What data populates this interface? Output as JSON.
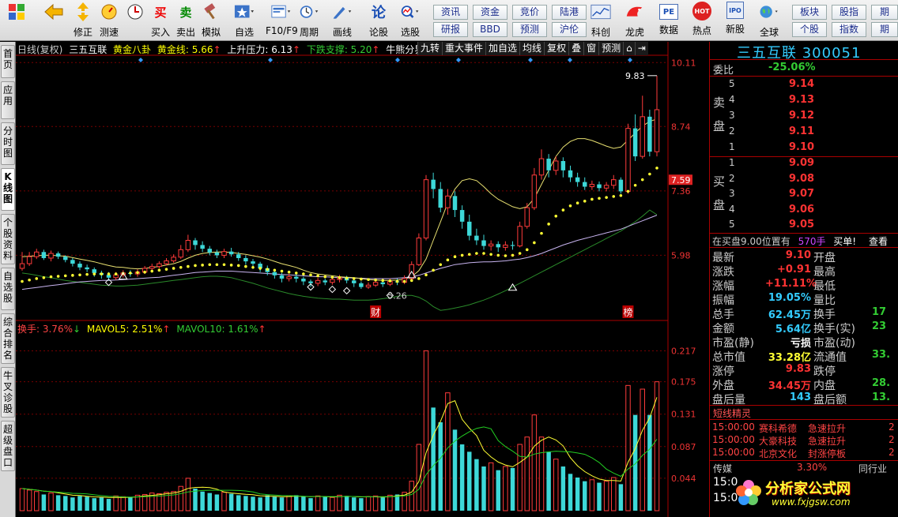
{
  "toolbar": {
    "buttons": [
      {
        "label": "",
        "icon": "grid-icon"
      },
      {
        "label": "",
        "icon": "back-arrow-icon"
      },
      {
        "label": "修正",
        "icon": "updown-arrow-icon"
      },
      {
        "label": "测速",
        "icon": "speed-icon"
      },
      {
        "label": "买入",
        "icon": "buy-icon",
        "glyph": "买"
      },
      {
        "label": "卖出",
        "icon": "sell-icon",
        "glyph": "卖"
      },
      {
        "label": "模拟",
        "icon": "hammer-icon"
      },
      {
        "label": "自选",
        "icon": "star-icon"
      },
      {
        "label": "F10/F9",
        "icon": "f10-icon"
      },
      {
        "label": "周期",
        "icon": "clock-icon"
      },
      {
        "label": "画线",
        "icon": "pen-icon"
      },
      {
        "label": "论股",
        "icon": "forum-icon",
        "glyph": "论"
      },
      {
        "label": "选股",
        "icon": "magnifier-icon"
      }
    ],
    "grid_buttons": [
      "资讯",
      "资金",
      "竞价",
      "陆港",
      "研报",
      "BBD",
      "预测",
      "沪伦"
    ],
    "buttons2": [
      {
        "label": "科创",
        "icon": "chart-icon"
      },
      {
        "label": "龙虎",
        "icon": "tiger-icon"
      },
      {
        "label": "数据",
        "icon": "pe-icon",
        "glyph": "PE"
      },
      {
        "label": "热点",
        "icon": "hot-icon",
        "glyph": "HOT"
      },
      {
        "label": "新股",
        "icon": "ipo-icon",
        "glyph": "IPO"
      },
      {
        "label": "全球",
        "icon": "globe-icon"
      }
    ],
    "grid_buttons2": [
      "板块",
      "股指",
      "期",
      "个股",
      "指数",
      "期"
    ]
  },
  "left_tabs": [
    "首页",
    "应用",
    "分时图",
    "K线图",
    "个股资料",
    "自选股",
    "综合排名",
    "牛叉诊股",
    "超级盘口"
  ],
  "chart": {
    "header": {
      "period": "日线(复权)",
      "name": "三五互联",
      "indicator": "黄金八卦",
      "gold_line": "黄金线: 5.66",
      "resistance": "上升压力: 6.13",
      "support": "下跌支撑: 5.20",
      "divider": "牛熊分界线"
    },
    "buttons": [
      "九转",
      "重大事件",
      "加自选",
      "均线",
      "复权",
      "叠",
      "窗",
      "预测"
    ],
    "price_axis": [
      "10.11",
      "8.74",
      "7.59",
      "7.36",
      "5.98"
    ],
    "price_marks": {
      "high": "9.83",
      "low": "5.26"
    },
    "event_labels": [
      "财",
      "榜"
    ],
    "vol_header": {
      "turnover": "换手: 3.76%",
      "mavol5": "MAVOL5: 2.51%",
      "mavol10": "MAVOL10: 1.61%"
    },
    "vol_axis": [
      "0.217",
      "0.175",
      "0.131",
      "0.087",
      "0.044"
    ]
  },
  "chart_data": {
    "type": "candlestick",
    "ylim": [
      4.6,
      10.25
    ],
    "candles": [
      [
        5.7,
        5.8,
        6.05,
        5.65
      ],
      [
        5.8,
        5.95,
        6.05,
        5.75
      ],
      [
        5.95,
        6.05,
        6.12,
        5.9
      ],
      [
        6.05,
        5.92,
        6.1,
        5.88
      ],
      [
        5.92,
        6.02,
        6.08,
        5.85
      ],
      [
        6.02,
        5.95,
        6.06,
        5.9
      ],
      [
        5.95,
        5.88,
        5.98,
        5.83
      ],
      [
        5.88,
        5.8,
        5.92,
        5.74
      ],
      [
        5.8,
        5.72,
        5.85,
        5.66
      ],
      [
        5.72,
        5.68,
        5.78,
        5.62
      ],
      [
        5.68,
        5.6,
        5.72,
        5.52
      ],
      [
        5.6,
        5.56,
        5.65,
        5.48
      ],
      [
        5.56,
        5.5,
        5.62,
        5.44
      ],
      [
        5.5,
        5.56,
        5.62,
        5.45
      ],
      [
        5.56,
        5.6,
        5.66,
        5.5
      ],
      [
        5.6,
        5.58,
        5.66,
        5.52
      ],
      [
        5.58,
        5.62,
        5.68,
        5.52
      ],
      [
        5.62,
        5.7,
        5.75,
        5.58
      ],
      [
        5.7,
        5.74,
        5.8,
        5.65
      ],
      [
        5.74,
        5.8,
        5.85,
        5.7
      ],
      [
        5.8,
        5.86,
        5.92,
        5.76
      ],
      [
        5.86,
        5.94,
        6.0,
        5.82
      ],
      [
        5.94,
        6.1,
        6.2,
        5.9
      ],
      [
        6.1,
        6.3,
        6.42,
        6.05
      ],
      [
        6.3,
        6.2,
        6.35,
        6.1
      ],
      [
        6.2,
        6.12,
        6.28,
        6.05
      ],
      [
        6.12,
        6.04,
        6.18,
        5.98
      ],
      [
        6.04,
        5.98,
        6.1,
        5.92
      ],
      [
        5.98,
        6.06,
        6.12,
        5.92
      ],
      [
        6.06,
        6.0,
        6.14,
        5.95
      ],
      [
        6.0,
        5.92,
        6.05,
        5.86
      ],
      [
        5.92,
        5.85,
        5.98,
        5.78
      ],
      [
        5.85,
        5.8,
        5.9,
        5.72
      ],
      [
        5.8,
        5.7,
        5.84,
        5.62
      ],
      [
        5.7,
        5.62,
        5.76,
        5.55
      ],
      [
        5.62,
        5.55,
        5.68,
        5.48
      ],
      [
        5.55,
        5.48,
        5.6,
        5.4
      ],
      [
        5.48,
        5.52,
        5.58,
        5.42
      ],
      [
        5.52,
        5.48,
        5.58,
        5.4
      ],
      [
        5.48,
        5.42,
        5.52,
        5.34
      ],
      [
        5.42,
        5.38,
        5.46,
        5.3
      ],
      [
        5.38,
        5.44,
        5.5,
        5.32
      ],
      [
        5.44,
        5.4,
        5.48,
        5.34
      ],
      [
        5.4,
        5.46,
        5.52,
        5.35
      ],
      [
        5.46,
        5.5,
        5.56,
        5.4
      ],
      [
        5.5,
        5.44,
        5.54,
        5.38
      ],
      [
        5.44,
        5.38,
        5.48,
        5.3
      ],
      [
        5.38,
        5.3,
        5.42,
        5.26
      ],
      [
        5.3,
        5.34,
        5.4,
        5.26
      ],
      [
        5.34,
        5.4,
        5.46,
        5.3
      ],
      [
        5.4,
        5.36,
        5.46,
        5.3
      ],
      [
        5.36,
        5.42,
        5.48,
        5.32
      ],
      [
        5.42,
        5.4,
        5.48,
        5.34
      ],
      [
        5.4,
        5.48,
        5.55,
        5.36
      ],
      [
        5.48,
        5.78,
        5.85,
        5.45
      ],
      [
        5.78,
        6.35,
        6.45,
        5.75
      ],
      [
        6.35,
        7.6,
        7.7,
        6.3
      ],
      [
        7.6,
        7.4,
        7.75,
        7.2
      ],
      [
        7.4,
        7.0,
        7.55,
        6.9
      ],
      [
        7.0,
        7.25,
        7.4,
        6.85
      ],
      [
        7.25,
        6.95,
        7.35,
        6.8
      ],
      [
        6.95,
        6.7,
        7.05,
        6.55
      ],
      [
        6.7,
        6.4,
        6.85,
        6.3
      ],
      [
        6.4,
        6.3,
        6.55,
        6.2
      ],
      [
        6.3,
        6.18,
        6.42,
        6.1
      ],
      [
        6.18,
        6.22,
        6.3,
        6.08
      ],
      [
        6.22,
        6.15,
        6.28,
        6.05
      ],
      [
        6.15,
        6.2,
        6.28,
        6.08
      ],
      [
        6.2,
        6.18,
        6.28,
        6.1
      ],
      [
        6.18,
        6.6,
        6.7,
        6.15
      ],
      [
        6.6,
        7.0,
        7.1,
        6.55
      ],
      [
        7.0,
        7.7,
        7.85,
        6.95
      ],
      [
        7.7,
        8.05,
        8.25,
        7.6
      ],
      [
        8.05,
        7.8,
        8.15,
        7.65
      ],
      [
        7.8,
        8.0,
        8.1,
        7.7
      ],
      [
        8.0,
        7.8,
        8.08,
        7.65
      ],
      [
        7.8,
        7.65,
        7.9,
        7.55
      ],
      [
        7.65,
        7.55,
        7.75,
        7.45
      ],
      [
        7.55,
        7.45,
        7.65,
        7.38
      ],
      [
        7.45,
        7.5,
        7.58,
        7.38
      ],
      [
        7.5,
        7.42,
        7.56,
        7.35
      ],
      [
        7.42,
        7.48,
        7.55,
        7.35
      ],
      [
        7.48,
        7.6,
        7.7,
        7.4
      ],
      [
        7.6,
        7.35,
        7.65,
        7.3
      ],
      [
        7.35,
        8.7,
        8.8,
        7.3
      ],
      [
        8.7,
        8.1,
        9.0,
        8.0
      ],
      [
        8.1,
        8.95,
        9.4,
        8.05
      ],
      [
        8.95,
        8.2,
        9.1,
        8.1
      ],
      [
        8.2,
        9.1,
        9.83,
        8.1
      ]
    ],
    "volume": [
      0.03,
      0.028,
      0.026,
      0.022,
      0.024,
      0.021,
      0.02,
      0.018,
      0.02,
      0.019,
      0.017,
      0.018,
      0.016,
      0.02,
      0.019,
      0.018,
      0.021,
      0.022,
      0.024,
      0.023,
      0.025,
      0.026,
      0.033,
      0.044,
      0.03,
      0.026,
      0.024,
      0.022,
      0.025,
      0.023,
      0.021,
      0.02,
      0.019,
      0.018,
      0.021,
      0.019,
      0.018,
      0.02,
      0.021,
      0.019,
      0.017,
      0.02,
      0.019,
      0.018,
      0.021,
      0.02,
      0.018,
      0.017,
      0.019,
      0.02,
      0.018,
      0.021,
      0.022,
      0.025,
      0.04,
      0.09,
      0.217,
      0.14,
      0.12,
      0.16,
      0.11,
      0.09,
      0.08,
      0.07,
      0.06,
      0.065,
      0.055,
      0.06,
      0.058,
      0.09,
      0.1,
      0.13,
      0.1,
      0.08,
      0.07,
      0.06,
      0.05,
      0.045,
      0.04,
      0.042,
      0.038,
      0.04,
      0.045,
      0.036,
      0.17,
      0.13,
      0.165,
      0.13,
      0.175
    ],
    "ma_yellow": [
      5.95,
      5.96,
      5.97,
      5.98,
      5.98,
      5.97,
      5.96,
      5.93,
      5.9,
      5.87,
      5.84,
      5.8,
      5.76,
      5.73,
      5.72,
      5.7,
      5.69,
      5.7,
      5.72,
      5.74,
      5.77,
      5.8,
      5.85,
      5.92,
      5.98,
      6.02,
      6.04,
      6.05,
      6.05,
      6.04,
      6.02,
      6.0,
      5.97,
      5.94,
      5.9,
      5.85,
      5.8,
      5.76,
      5.72,
      5.66,
      5.61,
      5.58,
      5.56,
      5.54,
      5.52,
      5.51,
      5.5,
      5.48,
      5.46,
      5.45,
      5.44,
      5.44,
      5.45,
      5.47,
      5.52,
      5.65,
      5.9,
      6.3,
      6.7,
      7.1,
      7.4,
      7.58,
      7.62,
      7.58,
      7.45,
      7.3,
      7.18,
      7.1,
      7.02,
      6.98,
      7.02,
      7.2,
      7.5,
      7.8,
      8.1,
      8.3,
      8.42,
      8.48,
      8.48,
      8.44,
      8.38,
      8.32,
      8.27,
      8.3,
      8.45,
      8.6,
      8.75,
      8.85,
      8.9
    ],
    "ma_dotted": [
      5.42,
      5.45,
      5.48,
      5.5,
      5.52,
      5.53,
      5.54,
      5.55,
      5.56,
      5.57,
      5.58,
      5.58,
      5.58,
      5.58,
      5.59,
      5.6,
      5.61,
      5.62,
      5.64,
      5.66,
      5.68,
      5.7,
      5.72,
      5.74,
      5.76,
      5.77,
      5.78,
      5.78,
      5.78,
      5.77,
      5.76,
      5.74,
      5.72,
      5.7,
      5.68,
      5.66,
      5.64,
      5.62,
      5.6,
      5.58,
      5.56,
      5.54,
      5.52,
      5.51,
      5.5,
      5.49,
      5.48,
      5.47,
      5.46,
      5.45,
      5.44,
      5.43,
      5.42,
      5.42,
      5.44,
      5.48,
      5.56,
      5.66,
      5.78,
      5.88,
      5.95,
      5.98,
      6.0,
      6.02,
      6.02,
      6.0,
      5.98,
      5.97,
      5.98,
      6.02,
      6.1,
      6.25,
      6.45,
      6.65,
      6.82,
      6.95,
      7.04,
      7.1,
      7.14,
      7.18,
      7.2,
      7.22,
      7.24,
      7.26,
      7.35,
      7.48,
      7.6,
      7.72,
      7.85
    ],
    "ma_white": [
      5.25,
      5.27,
      5.29,
      5.31,
      5.33,
      5.35,
      5.37,
      5.39,
      5.41,
      5.42,
      5.43,
      5.44,
      5.44,
      5.45,
      5.46,
      5.47,
      5.48,
      5.49,
      5.5,
      5.51,
      5.53,
      5.55,
      5.57,
      5.59,
      5.61,
      5.62,
      5.63,
      5.64,
      5.64,
      5.64,
      5.63,
      5.62,
      5.61,
      5.6,
      5.59,
      5.58,
      5.57,
      5.56,
      5.55,
      5.54,
      5.53,
      5.52,
      5.52,
      5.51,
      5.5,
      5.5,
      5.49,
      5.49,
      5.48,
      5.48,
      5.48,
      5.48,
      5.49,
      5.5,
      5.52,
      5.55,
      5.6,
      5.65,
      5.7,
      5.74,
      5.78,
      5.8,
      5.82,
      5.83,
      5.84,
      5.84,
      5.85,
      5.86,
      5.88,
      5.9,
      5.93,
      5.97,
      6.02,
      6.08,
      6.14,
      6.2,
      6.25,
      6.3,
      6.34,
      6.38,
      6.42,
      6.46,
      6.5,
      6.54,
      6.6,
      6.66,
      6.72,
      6.78,
      6.84
    ],
    "ma_green": [
      5.6,
      5.58,
      5.55,
      5.52,
      5.5,
      5.47,
      5.44,
      5.42,
      5.4,
      5.38,
      5.36,
      5.34,
      5.33,
      5.32,
      5.32,
      5.33,
      5.34,
      5.36,
      5.38,
      5.4,
      5.42,
      5.44,
      5.46,
      5.48,
      5.5,
      5.52,
      5.53,
      5.53,
      5.52,
      5.5,
      5.46,
      5.42,
      5.38,
      5.33,
      5.28,
      5.24,
      5.2,
      5.16,
      5.13,
      5.1,
      5.08,
      5.06,
      5.05,
      5.04,
      5.04,
      5.03,
      5.02,
      5.02,
      5.02,
      5.03,
      5.05,
      5.07,
      5.1,
      5.12,
      5.12,
      5.08,
      5.0,
      4.88,
      4.8,
      4.82,
      4.85,
      4.88,
      4.92,
      4.97,
      5.02,
      5.08,
      5.15,
      5.22,
      5.3,
      5.38,
      5.46,
      5.54,
      5.62,
      5.7,
      5.78,
      5.86,
      5.94,
      6.02,
      6.1,
      6.18,
      6.26,
      6.34,
      6.42,
      6.5,
      6.6,
      6.7,
      6.82,
      6.95,
      6.85
    ]
  },
  "quote": {
    "title": "三五互联 300051",
    "weibi_label": "委比",
    "weibi_value": "-25.06%",
    "sell_label": "卖盘",
    "buy_label": "买盘",
    "asks": [
      {
        "lvl": "5",
        "price": "9.14"
      },
      {
        "lvl": "4",
        "price": "9.13"
      },
      {
        "lvl": "3",
        "price": "9.12"
      },
      {
        "lvl": "2",
        "price": "9.11"
      },
      {
        "lvl": "1",
        "price": "9.10"
      }
    ],
    "bids": [
      {
        "lvl": "1",
        "price": "9.09"
      },
      {
        "lvl": "2",
        "price": "9.08"
      },
      {
        "lvl": "3",
        "price": "9.07"
      },
      {
        "lvl": "4",
        "price": "9.06"
      },
      {
        "lvl": "5",
        "price": "9.05"
      }
    ],
    "notice": "在买盘9.00位置有",
    "notice_qty": "570手",
    "notice_tag": "买单!",
    "notice_btn": "查看",
    "stats": [
      {
        "k": "最新",
        "v": "9.10",
        "k2": "开盘",
        "v2": ""
      },
      {
        "k": "涨跌",
        "v": "+0.91",
        "k2": "最高",
        "v2": ""
      },
      {
        "k": "涨幅",
        "v": "+11.11%",
        "k2": "最低",
        "v2": ""
      },
      {
        "k": "振幅",
        "v": "19.05%",
        "k2": "量比",
        "v2": ""
      },
      {
        "k": "总手",
        "v": "62.45万",
        "k2": "换手",
        "v2": "17"
      },
      {
        "k": "金额",
        "v": "5.64亿",
        "k2": "换手(实)",
        "v2": "23"
      },
      {
        "k": "市盈(静)",
        "v": "亏损",
        "k2": "市盈(动)",
        "v2": ""
      },
      {
        "k": "总市值",
        "v": "33.28亿",
        "k2": "流通值",
        "v2": "33."
      },
      {
        "k": "涨停",
        "v": "9.83",
        "k2": "跌停",
        "v2": ""
      },
      {
        "k": "外盘",
        "v": "34.45万",
        "k2": "内盘",
        "v2": "28."
      },
      {
        "k": "盘后量",
        "v": "143",
        "k2": "盘后额",
        "v2": "13."
      }
    ],
    "jingling_title": "短线精灵",
    "jingling": [
      {
        "time": "15:00:00",
        "name": "赛科希德",
        "event": "急速拉升",
        "n": "2"
      },
      {
        "time": "15:00:00",
        "name": "大豪科技",
        "event": "急速拉升",
        "n": "2"
      },
      {
        "time": "15:00:00",
        "name": "北京文化",
        "event": "封涨停板",
        "n": "2"
      }
    ],
    "sector": "传媒",
    "sector_pct": "3.30%",
    "sector_btn": "同行业",
    "times": [
      "15:0",
      "15:0"
    ],
    "watermark": "分析家公式网",
    "watermark_url": "www.fxjgsw.com"
  }
}
